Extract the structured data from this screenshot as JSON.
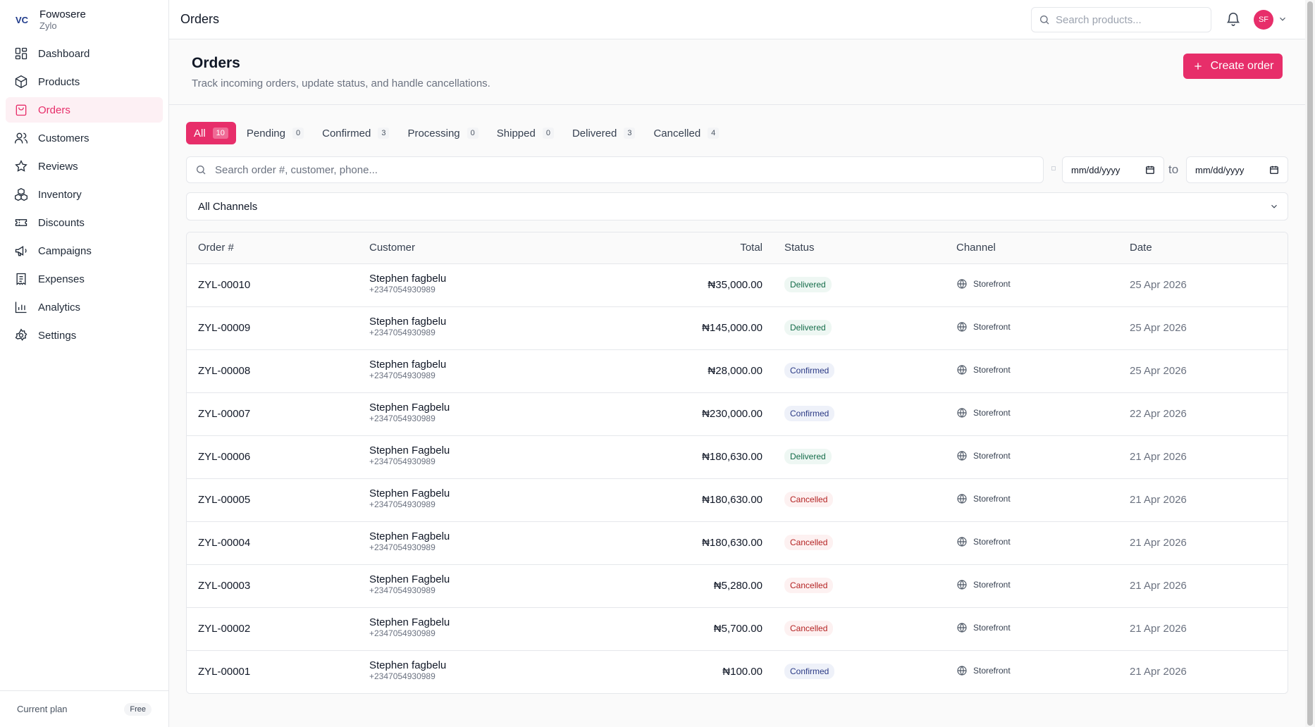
{
  "brand": {
    "name": "Fowosere",
    "sub": "Zylo",
    "logo": "VC"
  },
  "nav": [
    {
      "label": "Dashboard",
      "icon": "dashboard-icon"
    },
    {
      "label": "Products",
      "icon": "box-icon"
    },
    {
      "label": "Orders",
      "icon": "shopping-bag-icon",
      "active": true
    },
    {
      "label": "Customers",
      "icon": "users-icon"
    },
    {
      "label": "Reviews",
      "icon": "star-icon"
    },
    {
      "label": "Inventory",
      "icon": "boxes-icon"
    },
    {
      "label": "Discounts",
      "icon": "ticket-icon"
    },
    {
      "label": "Campaigns",
      "icon": "megaphone-icon"
    },
    {
      "label": "Expenses",
      "icon": "receipt-icon"
    },
    {
      "label": "Analytics",
      "icon": "bar-chart-icon"
    },
    {
      "label": "Settings",
      "icon": "gear-icon"
    }
  ],
  "plan": {
    "label": "Current plan",
    "value": "Free"
  },
  "topbar": {
    "title": "Orders",
    "search_placeholder": "Search products...",
    "avatar": "SF"
  },
  "header": {
    "title": "Orders",
    "subtitle": "Track incoming orders, update status, and handle cancellations.",
    "create_label": "Create order"
  },
  "tabs": [
    {
      "label": "All",
      "count": "10",
      "active": true
    },
    {
      "label": "Pending",
      "count": "0"
    },
    {
      "label": "Confirmed",
      "count": "3"
    },
    {
      "label": "Processing",
      "count": "0"
    },
    {
      "label": "Shipped",
      "count": "0"
    },
    {
      "label": "Delivered",
      "count": "3"
    },
    {
      "label": "Cancelled",
      "count": "4"
    }
  ],
  "filters": {
    "search_placeholder": "Search order #, customer, phone...",
    "date_from": "mm/dd/yyyy",
    "date_to": "mm/dd/yyyy",
    "to_label": "to",
    "channel": "All Channels"
  },
  "table": {
    "columns": [
      "Order #",
      "Customer",
      "Total",
      "Status",
      "Channel",
      "Date"
    ],
    "rows": [
      {
        "order": "ZYL-00010",
        "customer": "Stephen fagbelu",
        "phone": "+2347054930989",
        "total": "₦35,000.00",
        "status": "Delivered",
        "channel": "Storefront",
        "date": "25 Apr 2026"
      },
      {
        "order": "ZYL-00009",
        "customer": "Stephen fagbelu",
        "phone": "+2347054930989",
        "total": "₦145,000.00",
        "status": "Delivered",
        "channel": "Storefront",
        "date": "25 Apr 2026"
      },
      {
        "order": "ZYL-00008",
        "customer": "Stephen fagbelu",
        "phone": "+2347054930989",
        "total": "₦28,000.00",
        "status": "Confirmed",
        "channel": "Storefront",
        "date": "25 Apr 2026"
      },
      {
        "order": "ZYL-00007",
        "customer": "Stephen Fagbelu",
        "phone": "+2347054930989",
        "total": "₦230,000.00",
        "status": "Confirmed",
        "channel": "Storefront",
        "date": "22 Apr 2026"
      },
      {
        "order": "ZYL-00006",
        "customer": "Stephen Fagbelu",
        "phone": "+2347054930989",
        "total": "₦180,630.00",
        "status": "Delivered",
        "channel": "Storefront",
        "date": "21 Apr 2026"
      },
      {
        "order": "ZYL-00005",
        "customer": "Stephen Fagbelu",
        "phone": "+2347054930989",
        "total": "₦180,630.00",
        "status": "Cancelled",
        "channel": "Storefront",
        "date": "21 Apr 2026"
      },
      {
        "order": "ZYL-00004",
        "customer": "Stephen Fagbelu",
        "phone": "+2347054930989",
        "total": "₦180,630.00",
        "status": "Cancelled",
        "channel": "Storefront",
        "date": "21 Apr 2026"
      },
      {
        "order": "ZYL-00003",
        "customer": "Stephen Fagbelu",
        "phone": "+2347054930989",
        "total": "₦5,280.00",
        "status": "Cancelled",
        "channel": "Storefront",
        "date": "21 Apr 2026"
      },
      {
        "order": "ZYL-00002",
        "customer": "Stephen Fagbelu",
        "phone": "+2347054930989",
        "total": "₦5,700.00",
        "status": "Cancelled",
        "channel": "Storefront",
        "date": "21 Apr 2026"
      },
      {
        "order": "ZYL-00001",
        "customer": "Stephen fagbelu",
        "phone": "+2347054930989",
        "total": "₦100.00",
        "status": "Confirmed",
        "channel": "Storefront",
        "date": "21 Apr 2026"
      }
    ]
  },
  "colors": {
    "accent": "#e72e6a",
    "accent_bg": "#fdf0f4"
  }
}
